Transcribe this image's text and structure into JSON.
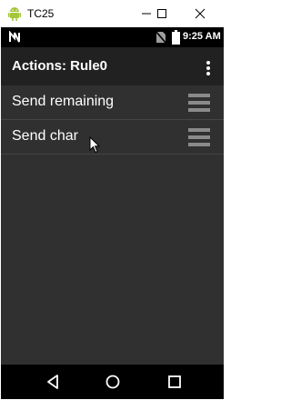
{
  "window": {
    "title": "TC25",
    "colors": {
      "titlebar": "#ffffff",
      "android_green": "#a4c639"
    }
  },
  "status_bar": {
    "time": "9:25 AM",
    "icons": [
      "notification-n-icon",
      "no-sim-icon",
      "battery-icon"
    ]
  },
  "app_bar": {
    "title": "Actions: Rule0",
    "menu_icon": "overflow-menu-icon"
  },
  "list": {
    "items": [
      {
        "label": "Send remaining",
        "handle_icon": "drag-handle-icon"
      },
      {
        "label": "Send char",
        "handle_icon": "drag-handle-icon"
      }
    ]
  },
  "nav_bar": {
    "icons": [
      "back-icon",
      "home-icon",
      "recents-icon"
    ]
  },
  "colors": {
    "screen_bg": "#303030",
    "app_bar_bg": "#212121",
    "status_bar_bg": "#000000",
    "divider": "#454545",
    "text": "#ffffff"
  }
}
